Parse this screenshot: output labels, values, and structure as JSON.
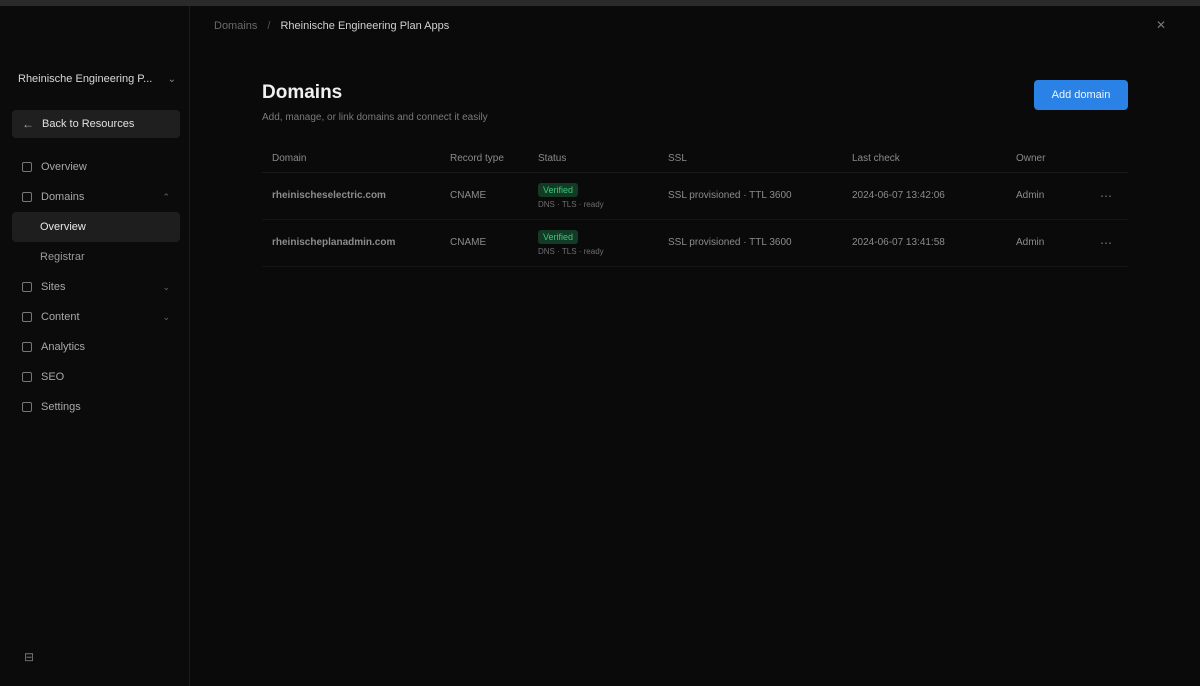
{
  "breadcrumb": {
    "parent": "Domains",
    "separator": "/",
    "current": "Rheinische Engineering Plan Apps"
  },
  "workspace": {
    "name": "Rheinische Engineering P...",
    "chevron": "⌄"
  },
  "sidebar": {
    "back_label": "Back to Resources",
    "items": [
      {
        "label": "Overview",
        "icon": "grid-icon"
      },
      {
        "label": "Domains",
        "icon": "globe-icon",
        "expanded": true,
        "children": [
          {
            "label": "Overview",
            "active": true
          },
          {
            "label": "Registrar",
            "active": false
          }
        ]
      },
      {
        "label": "Sites",
        "icon": "layers-icon",
        "collapsible": true
      },
      {
        "label": "Content",
        "icon": "file-icon",
        "collapsible": true
      },
      {
        "label": "Analytics",
        "icon": "chart-icon"
      },
      {
        "label": "SEO",
        "icon": "search-icon"
      },
      {
        "label": "Settings",
        "icon": "gear-icon"
      }
    ],
    "footer_icon": "collapse-sidebar-icon"
  },
  "header_icon": "close-icon",
  "page": {
    "title": "Domains",
    "subtitle": "Add, manage, or link domains and connect it easily",
    "add_button": "Add domain"
  },
  "table": {
    "columns": [
      "Domain",
      "Record type",
      "Status",
      "SSL",
      "Last check",
      "Owner"
    ],
    "rows": [
      {
        "domain": "rheinischeselectric.com",
        "record": "CNAME",
        "status": "Verified",
        "status_note": "DNS · TLS · ready",
        "ssl": "SSL provisioned · TTL 3600",
        "last_check": "2024-06-07 13:42:06",
        "owner": "Admin"
      },
      {
        "domain": "rheinischeplanadmin.com",
        "record": "CNAME",
        "status": "Verified",
        "status_note": "DNS · TLS · ready",
        "ssl": "SSL provisioned · TTL 3600",
        "last_check": "2024-06-07 13:41:58",
        "owner": "Admin"
      }
    ]
  },
  "colors": {
    "accent": "#2b82e6",
    "success": "#3ec77a",
    "background": "#0a0a0a"
  }
}
